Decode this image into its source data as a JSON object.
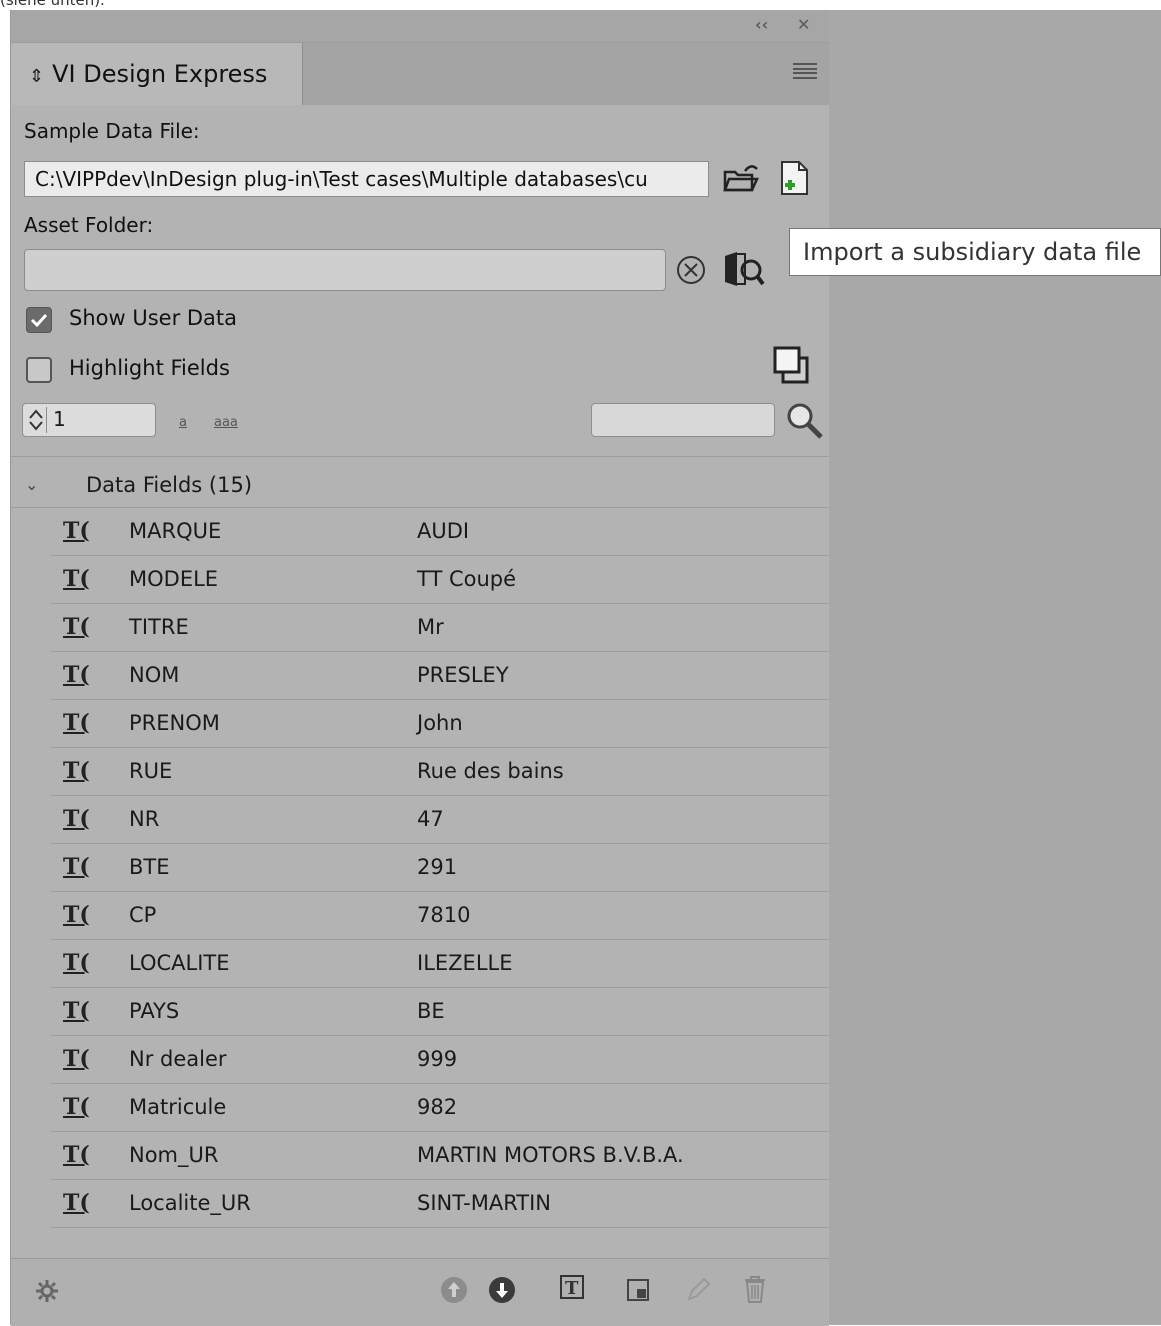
{
  "top_fragment": "(siehe unten).",
  "panel": {
    "title": "VI Design Express",
    "sample_label": "Sample Data File:",
    "sample_path": "C:\\VIPPdev\\InDesign plug-in\\Test cases\\Multiple databases\\cu",
    "asset_label": "Asset Folder:",
    "asset_value": "",
    "show_user_data": {
      "label": "Show User Data",
      "checked": true
    },
    "highlight_fields": {
      "label": "Highlight Fields",
      "checked": false
    },
    "record_number": "1",
    "link_a": "a",
    "link_aaa": "aaa",
    "search_value": "",
    "section_title": "Data Fields (15)"
  },
  "fields": [
    {
      "name": "MARQUE",
      "value": "AUDI"
    },
    {
      "name": "MODELE",
      "value": "TT Coupé"
    },
    {
      "name": "TITRE",
      "value": "Mr"
    },
    {
      "name": "NOM",
      "value": "PRESLEY"
    },
    {
      "name": "PRENOM",
      "value": "John"
    },
    {
      "name": "RUE",
      "value": "Rue des bains"
    },
    {
      "name": "NR",
      "value": "47"
    },
    {
      "name": "BTE",
      "value": "291"
    },
    {
      "name": "CP",
      "value": "7810"
    },
    {
      "name": "LOCALITE",
      "value": "ILEZELLE"
    },
    {
      "name": "PAYS",
      "value": "BE"
    },
    {
      "name": "Nr dealer",
      "value": "999"
    },
    {
      "name": "Matricule",
      "value": "982"
    },
    {
      "name": "Nom_UR",
      "value": "MARTIN MOTORS B.V.B.A."
    },
    {
      "name": "Localite_UR",
      "value": "SINT-MARTIN"
    }
  ],
  "tooltip": "Import a subsidiary data file",
  "icons": {
    "collapse": "double-chevron-left-icon",
    "close": "close-icon",
    "menu": "hamburger-menu-icon",
    "open_folder": "open-folder-icon",
    "import_file": "import-file-icon",
    "clear": "clear-circle-icon",
    "browse_folder": "browse-folder-icon",
    "preview": "preview-icon",
    "search": "search-icon",
    "text_field": "text-field-icon",
    "settings": "gear-icon",
    "move_up": "move-up-icon",
    "move_down": "move-down-icon",
    "insert_text": "insert-text-icon",
    "insert_image": "insert-image-icon",
    "edit": "edit-icon",
    "delete": "trash-icon"
  },
  "colors": {
    "panel_bg": "#b3b3b3",
    "background": "#a8a8a8",
    "tooltip_bg": "#ffffff"
  }
}
